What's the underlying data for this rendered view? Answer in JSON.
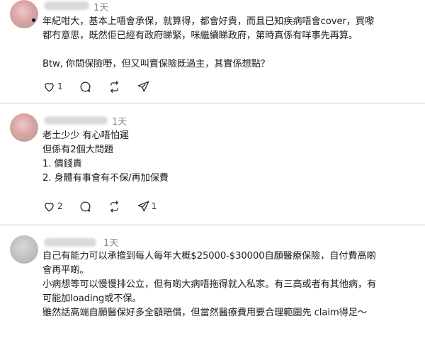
{
  "posts": [
    {
      "time": "1天",
      "lines": [
        "年紀咁大，基本上唔會承保，就算得，都會好貴，而且已知疾病唔會cover，買嚟",
        "都冇意思，既然佢已經有政府睇緊，咪繼續睇政府，第時真係有咩事先再算。",
        "",
        "Btw, 你問保險嘢，但又叫賣保險既過主，其實係想點？"
      ],
      "like_count": "1",
      "comment_count": "",
      "repost_count": ""
    },
    {
      "time": "1天",
      "lines": [
        "老土少少 有心唔怕遲",
        "但係有2個大問題",
        "1. 價錢貴",
        "2. 身體有事會有不保/再加保費"
      ],
      "like_count": "2",
      "comment_count": "",
      "repost_count": "1"
    },
    {
      "time": "1天",
      "lines": [
        "自己有能力可以承擔到每人每年大概$25000-$30000自願醫療保險，自付費高啲",
        "會再平啲。",
        "小病想等可以慢慢排公立，但有啲大病唔拖得就入私家。有三高或者有其他病，有",
        "可能加loading或不保。",
        "雖然話高端自願醫保好多全額賠償，但當然醫療費用要合理範圍先 claim得足～"
      ]
    }
  ],
  "icons": {
    "like": "heart-icon",
    "comment": "comment-icon",
    "repost": "repost-icon",
    "share": "send-icon"
  }
}
